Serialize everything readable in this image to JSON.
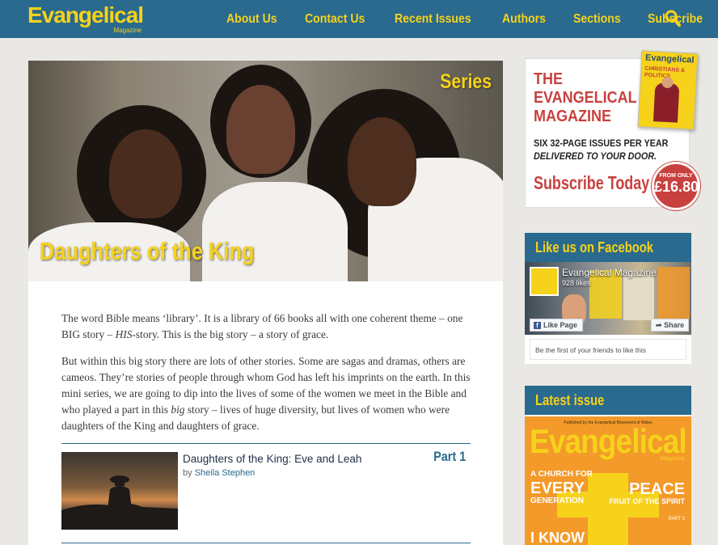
{
  "header": {
    "logo": "Evangelical",
    "logo_sub": "Magazine",
    "nav": [
      "About Us",
      "Contact Us",
      "Recent Issues",
      "Authors",
      "Sections",
      "Subscribe"
    ],
    "search_icon": "search-icon"
  },
  "hero": {
    "tag": "Series",
    "title": "Daughters of the King"
  },
  "article": {
    "p1_a": "The word Bible means ‘library’. It is a library of 66 books all with one coherent theme – one BIG story – ",
    "p1_em": "HIS",
    "p1_b": "-story. This is the big story – a story of grace.",
    "p2_a": "But within this big story there are lots of other stories. Some are sagas and dramas, others are cameos. They’re stories of people through whom God has left his imprints on the earth. In this mini series, we are going to dip into the lives of some of the women we meet in the Bible and who played a part in this ",
    "p2_em": "big",
    "p2_b": " story – lives of huge diversity, but lives of women who were daughters of the King and daughters of grace."
  },
  "entry": {
    "title": "Daughters of the King: Eve and Leah",
    "by": "by",
    "author": "Sheila Stephen",
    "part": "Part 1"
  },
  "ad": {
    "title": "THE EVANGELICAL MAGAZINE",
    "line1": "SIX 32-PAGE ISSUES PER YEAR",
    "line2": "DELIVERED TO YOUR DOOR.",
    "cta": "Subscribe Today",
    "badge_top": "FROM ONLY",
    "badge_price": "£16.80",
    "cover_title": "Evangelical",
    "cover_sub": "CHRISTIANS & POLITICS"
  },
  "facebook": {
    "heading": "Like us on Facebook",
    "page_name": "Evangelical Magazine",
    "likes": "928 likes",
    "like_button": "Like Page",
    "share_button": "Share",
    "friends_text": "Be the first of your friends to like this"
  },
  "latest": {
    "heading": "Latest issue",
    "top_line": "Published by the Evangelical Movement of Wales",
    "title": "Evangelical",
    "mag": "Magazine",
    "left1": "A CHURCH FOR",
    "left2": "EVERY",
    "left3": "GENERATION",
    "right1": "PEACE",
    "right2": "FRUIT OF THE SPIRIT",
    "right3": "PART 3",
    "bottom": "I KNOW"
  },
  "colors": {
    "brand_blue": "#2a6a8e",
    "brand_yellow": "#f6d21b",
    "accent_red": "#c8413f"
  }
}
